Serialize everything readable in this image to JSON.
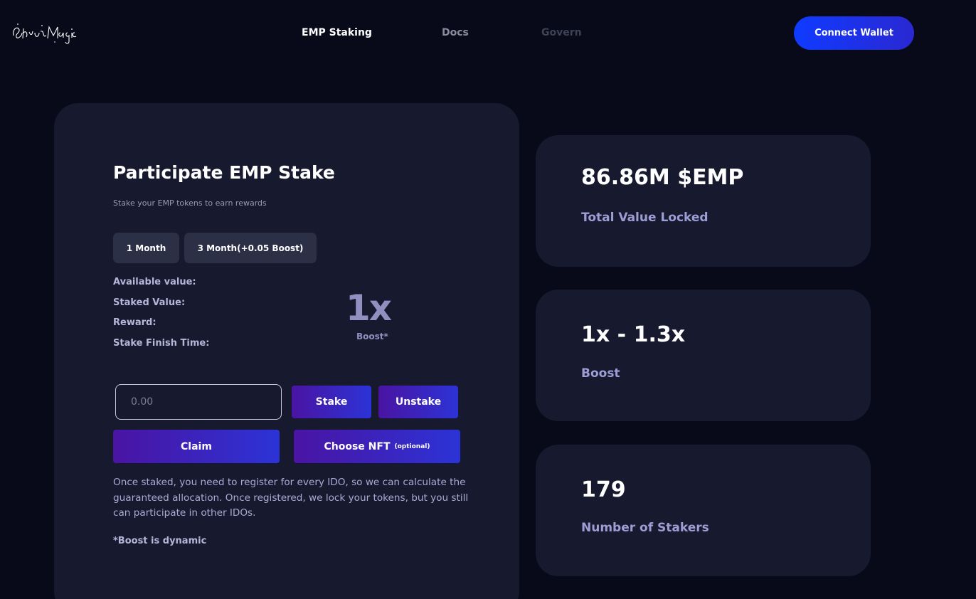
{
  "header": {
    "logo_text": "ElvishMagic",
    "nav": [
      {
        "label": "EMP Staking",
        "state": "active"
      },
      {
        "label": "Docs",
        "state": "normal"
      },
      {
        "label": "Govern",
        "state": "disabled"
      }
    ],
    "connect_wallet_label": "Connect Wallet"
  },
  "stake_panel": {
    "title": "Participate EMP Stake",
    "subtitle": "Stake your EMP tokens to earn rewards",
    "periods": [
      {
        "label": "1 Month"
      },
      {
        "label": "3 Month(+0.05 Boost)"
      }
    ],
    "info_labels": {
      "available": "Available value:",
      "staked": "Staked Value:",
      "reward": "Reward:",
      "finish_time": "Stake Finish Time:"
    },
    "boost": {
      "value": "1x",
      "caption": "Boost*"
    },
    "amount_input": {
      "value": "",
      "placeholder": "0.00"
    },
    "buttons": {
      "stake": "Stake",
      "unstake": "Unstake",
      "claim": "Claim",
      "choose_nft": "Choose NFT",
      "choose_nft_note": "(optional)"
    },
    "note": "Once staked, you need to register for every IDO, so we can calculate the guaranteed allocation. Once registered, we lock your tokens, but you still can participate in other IDOs.",
    "boost_note": "*Boost is dynamic"
  },
  "stats": {
    "tvl": {
      "value": "86.86M $EMP",
      "label": "Total Value Locked"
    },
    "boost": {
      "value": "1x - 1.3x",
      "label": "Boost"
    },
    "stakers": {
      "value": "179",
      "label": "Number of Stakers"
    }
  },
  "colors": {
    "background": "#080a19",
    "card": "#171a2e",
    "accent_blue": "#0f3bff",
    "gradient_purple": "#4a14a3",
    "label_lavender": "#9d9ed6"
  }
}
